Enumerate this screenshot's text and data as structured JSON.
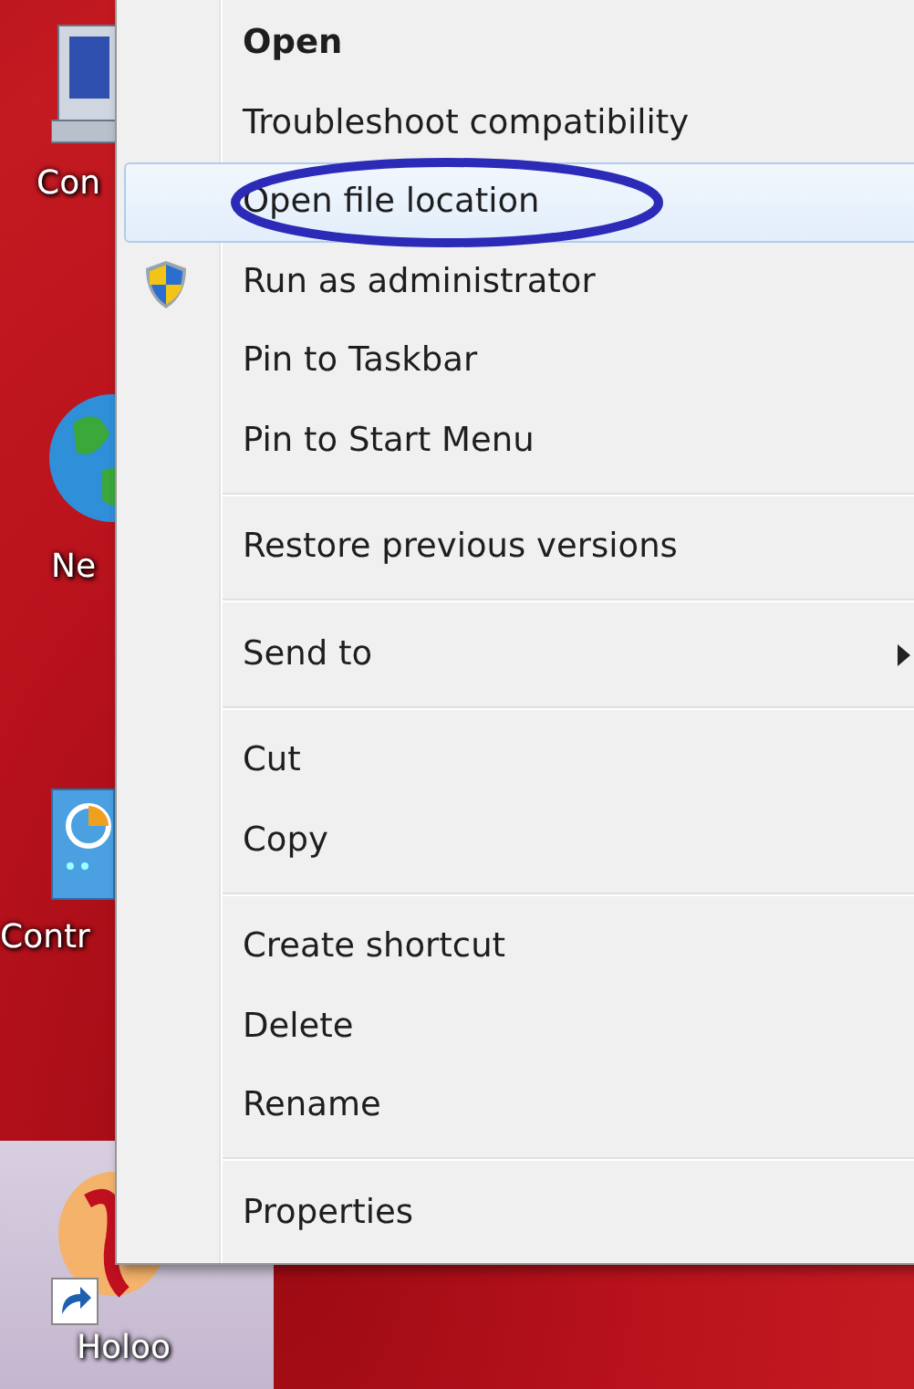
{
  "desktop": {
    "icons": [
      {
        "kind": "computer",
        "label": "Con",
        "selected": false
      },
      {
        "kind": "globe",
        "label": "Ne",
        "selected": false
      },
      {
        "kind": "control",
        "label": "Contr",
        "selected": false
      },
      {
        "kind": "app",
        "label": "Holoo",
        "selected": true,
        "shortcut": true
      }
    ]
  },
  "context_menu": {
    "items": [
      {
        "kind": "item",
        "label": "Open",
        "default": true,
        "selected": false,
        "circled": false,
        "submenu": false
      },
      {
        "kind": "item",
        "label": "Troubleshoot compatibility",
        "default": false,
        "selected": false,
        "circled": false,
        "submenu": false
      },
      {
        "kind": "item",
        "label": "Open file location",
        "default": false,
        "selected": true,
        "circled": true,
        "submenu": false
      },
      {
        "kind": "elevated",
        "label": "Run as administrator",
        "default": false,
        "selected": false,
        "circled": false,
        "submenu": false
      },
      {
        "kind": "item",
        "label": "Pin to Taskbar",
        "default": false,
        "selected": false,
        "circled": false,
        "submenu": false
      },
      {
        "kind": "item",
        "label": "Pin to Start Menu",
        "default": false,
        "selected": false,
        "circled": false,
        "submenu": false
      },
      {
        "kind": "separator"
      },
      {
        "kind": "item",
        "label": "Restore previous versions",
        "default": false,
        "selected": false,
        "circled": false,
        "submenu": false
      },
      {
        "kind": "separator"
      },
      {
        "kind": "item",
        "label": "Send to",
        "default": false,
        "selected": false,
        "circled": false,
        "submenu": true
      },
      {
        "kind": "separator"
      },
      {
        "kind": "item",
        "label": "Cut",
        "default": false,
        "selected": false,
        "circled": false,
        "submenu": false
      },
      {
        "kind": "item",
        "label": "Copy",
        "default": false,
        "selected": false,
        "circled": false,
        "submenu": false
      },
      {
        "kind": "separator"
      },
      {
        "kind": "item",
        "label": "Create shortcut",
        "default": false,
        "selected": false,
        "circled": false,
        "submenu": false
      },
      {
        "kind": "item",
        "label": "Delete",
        "default": false,
        "selected": false,
        "circled": false,
        "submenu": false
      },
      {
        "kind": "item",
        "label": "Rename",
        "default": false,
        "selected": false,
        "circled": false,
        "submenu": false
      },
      {
        "kind": "separator"
      },
      {
        "kind": "item",
        "label": "Properties",
        "default": false,
        "selected": false,
        "circled": false,
        "submenu": false
      }
    ]
  }
}
